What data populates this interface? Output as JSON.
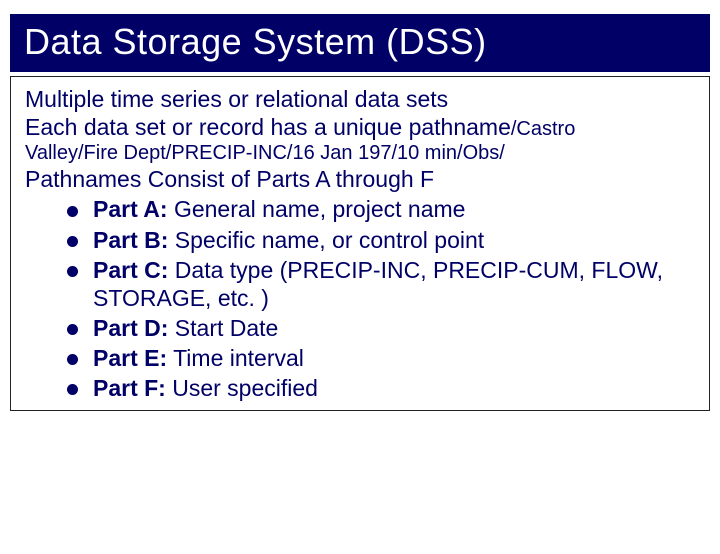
{
  "title": "Data Storage System (DSS)",
  "body": {
    "line1": "Multiple time series or relational data sets",
    "line2_a": "Each data set or record has a unique pathname",
    "line2_b": "/Castro",
    "line3": "Valley/Fire Dept/PRECIP-INC/16 Jan 197/10 min/Obs/",
    "parts_heading": "Pathnames Consist of Parts A through F",
    "parts": [
      {
        "label": "Part A:",
        "desc": " General name, project name"
      },
      {
        "label": "Part B:",
        "desc": " Specific name, or control point"
      },
      {
        "label": "Part C:",
        "desc": " Data type (PRECIP-INC, PRECIP-CUM, FLOW, STORAGE, etc. )"
      },
      {
        "label": "Part D:",
        "desc": " Start Date"
      },
      {
        "label": "Part E:",
        "desc": " Time interval"
      },
      {
        "label": "Part F:",
        "desc": " User specified"
      }
    ]
  }
}
